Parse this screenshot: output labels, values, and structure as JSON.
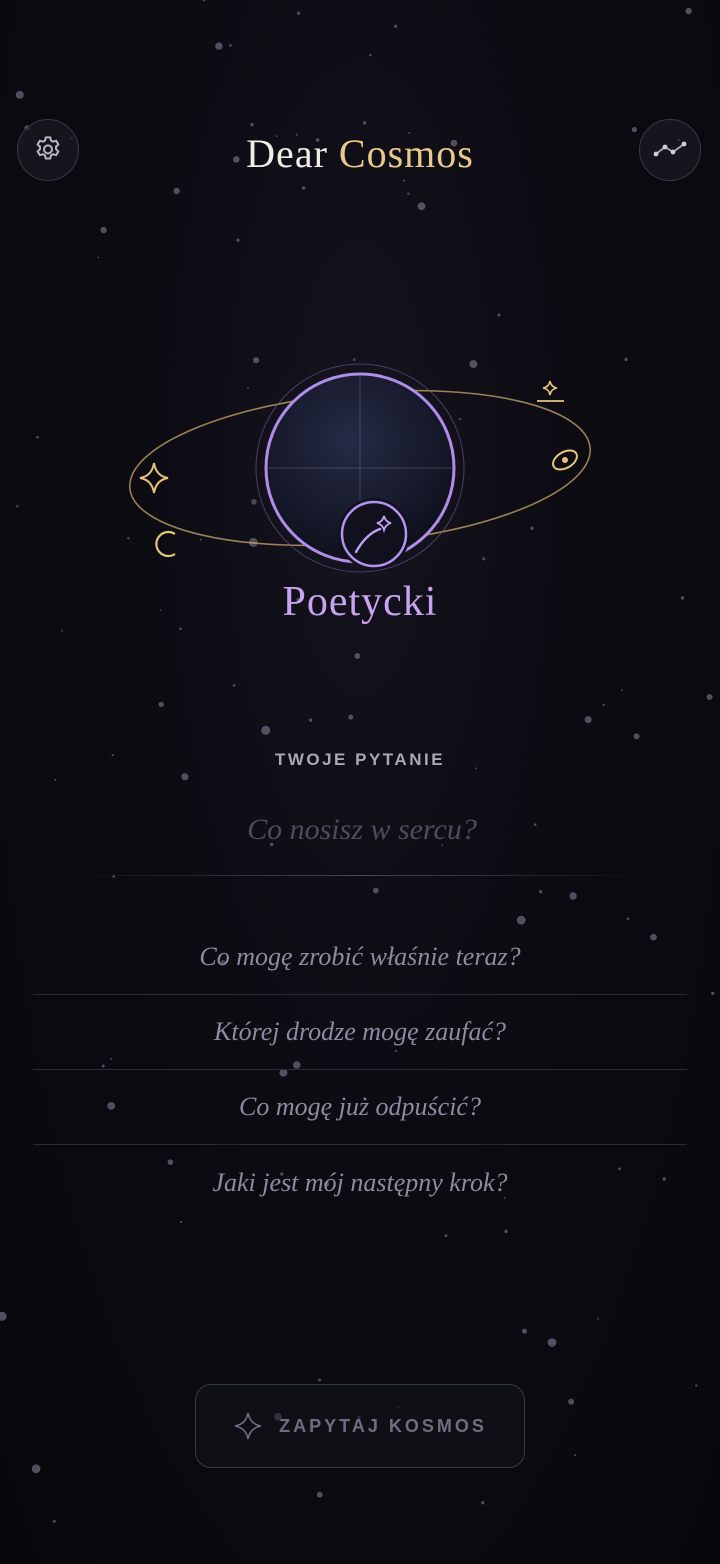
{
  "header": {
    "title_part1": "Dear",
    "title_part2": "Cosmos",
    "settings_icon": "gear-icon",
    "stats_icon": "trend-line-icon"
  },
  "mode": {
    "name": "Poetycki",
    "icon": "shooting-star-icon"
  },
  "question": {
    "label": "TWOJE PYTANIE",
    "placeholder": "Co nosisz w sercu?",
    "value": ""
  },
  "suggestions": [
    "Co mogę zrobić właśnie teraz?",
    "Której drodze mogę zaufać?",
    "Co mogę już odpuścić?",
    "Jaki jest mój następny krok?"
  ],
  "ask_button": {
    "label": "ZAPYTAJ KOSMOS",
    "icon": "sparkle-icon"
  },
  "colors": {
    "background": "#0b0a10",
    "accent_gold": "#e8c98a",
    "accent_purple": "#c9a3f2"
  }
}
